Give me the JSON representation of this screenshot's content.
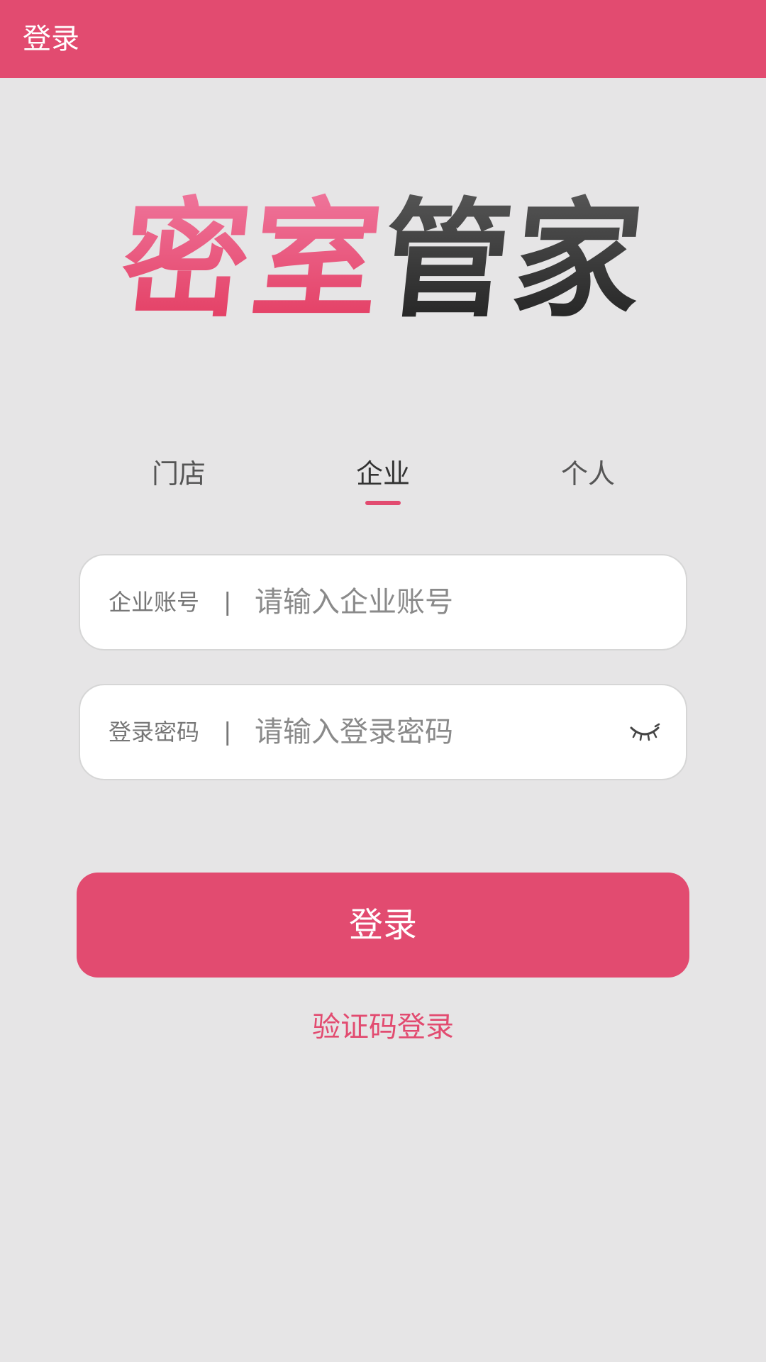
{
  "header": {
    "title": "登录"
  },
  "logo": {
    "part1": "密室",
    "part2": "管家"
  },
  "tabs": [
    {
      "label": "门店",
      "active": false
    },
    {
      "label": "企业",
      "active": true
    },
    {
      "label": "个人",
      "active": false
    }
  ],
  "form": {
    "account": {
      "label": "企业账号",
      "separator": "|",
      "value": "",
      "placeholder": "请输入企业账号"
    },
    "password": {
      "label": "登录密码",
      "separator": "|",
      "value": "",
      "placeholder": "请输入登录密码",
      "icon": "eye-closed-icon"
    }
  },
  "actions": {
    "login_label": "登录",
    "sms_login_label": "验证码登录"
  },
  "colors": {
    "accent": "#e24b70",
    "background": "#e6e5e6",
    "logo_dark": "#2e2e2e"
  }
}
